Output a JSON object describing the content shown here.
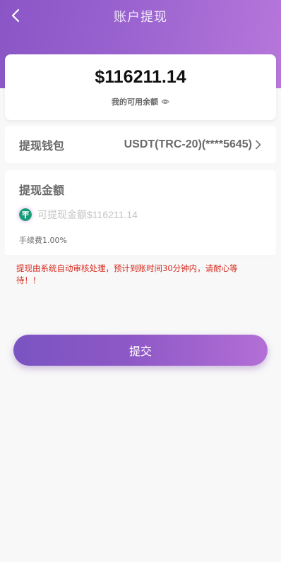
{
  "header": {
    "title": "账户提现",
    "back_icon": "chevron-left-icon"
  },
  "balance": {
    "amount": "$116211.14",
    "label": "我的可用余额",
    "visibility_icon": "eye-icon"
  },
  "wallet": {
    "label": "提现钱包",
    "value": "USDT(TRC-20)(****5645)",
    "chevron_icon": "chevron-right-icon"
  },
  "withdraw": {
    "title": "提现金额",
    "currency_icon": "usdt-icon",
    "input_value": "",
    "input_placeholder": "可提现金额$116211.14",
    "fee": "手续费1.00%"
  },
  "notice": "提现由系统自动审核处理，预计到账时间30分钟内，请耐心等待！！",
  "submit_label": "提交",
  "colors": {
    "brand_purple": "#9a63cf",
    "accent_green": "#1a9b78",
    "notice_red": "#d62a1e",
    "text_gray": "#6a6a6a"
  }
}
